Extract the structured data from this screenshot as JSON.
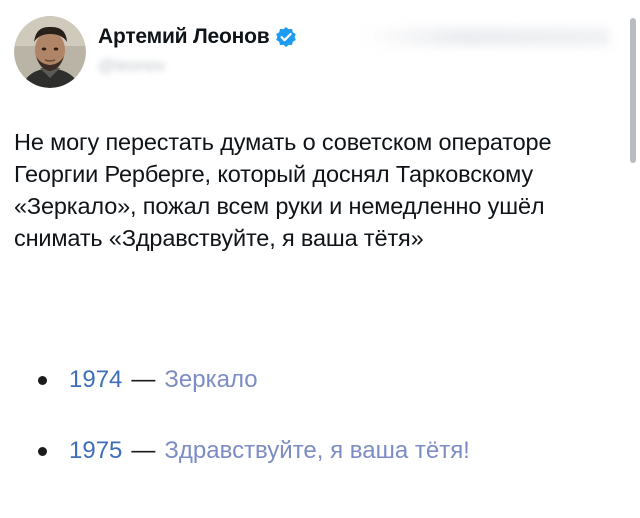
{
  "author": {
    "name": "Артемий Леонов",
    "handle": "@leonov",
    "avatar_icon": "avatar-photo",
    "verified_icon": "verified-badge-icon",
    "verified_color": "#1d9bf0"
  },
  "tweet": {
    "text": "Не могу перестать думать о советском операторе Георгии Рерберге, который доснял Тарковскому «Зеркало», пожал всем руки и немедленно ушёл снимать «Здравствуйте, я ваша тётя»"
  },
  "films": [
    {
      "year": "1974",
      "dash": "—",
      "title": "Зеркало"
    },
    {
      "year": "1975",
      "dash": "—",
      "title": "Здравствуйте, я ваша тётя!"
    }
  ],
  "colors": {
    "text": "#0f1419",
    "year_link": "#3d6fb8",
    "title_link": "#7c8cc4"
  }
}
